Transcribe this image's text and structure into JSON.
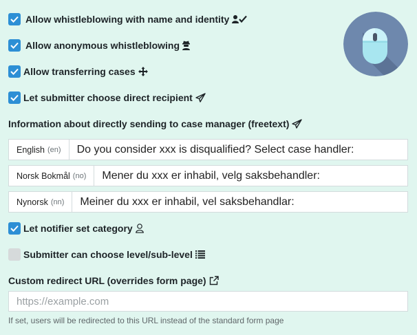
{
  "options": [
    {
      "label": "Allow whistleblowing with name and identity",
      "checked": true,
      "icon": "user-check-icon"
    },
    {
      "label": "Allow anonymous whistleblowing",
      "checked": true,
      "icon": "user-secret-icon"
    },
    {
      "label": "Allow transferring cases",
      "checked": true,
      "icon": "arrows-move-icon"
    },
    {
      "label": "Let submitter choose direct recipient",
      "checked": true,
      "icon": "paper-plane-icon"
    }
  ],
  "freetext": {
    "title": "Information about directly sending to case manager (freetext)",
    "icon": "paper-plane-icon",
    "languages": [
      {
        "name": "English",
        "code": "(en)",
        "value": "Do you consider xxx is disqualified? Select case handler:"
      },
      {
        "name": "Norsk Bokmål",
        "code": "(no)",
        "value": "Mener du xxx er inhabil, velg saksbehandler:"
      },
      {
        "name": "Nynorsk",
        "code": "(nn)",
        "value": "Meiner du xxx er inhabil, vel saksbehandlar:"
      }
    ]
  },
  "category_option": {
    "label": "Let notifier set category",
    "checked": true,
    "icon": "user-outline-icon"
  },
  "level_option": {
    "label": "Submitter can choose level/sub-level",
    "checked": false,
    "icon": "list-icon"
  },
  "redirect": {
    "title": "Custom redirect URL (overrides form page)",
    "icon": "external-link-icon",
    "placeholder": "https://example.com",
    "value": "",
    "help": "If set, users will be redirected to this URL instead of the standard form page"
  },
  "colors": {
    "background": "#e0f6ef",
    "accent": "#2d8fd5",
    "badge": "#6e88ad"
  }
}
